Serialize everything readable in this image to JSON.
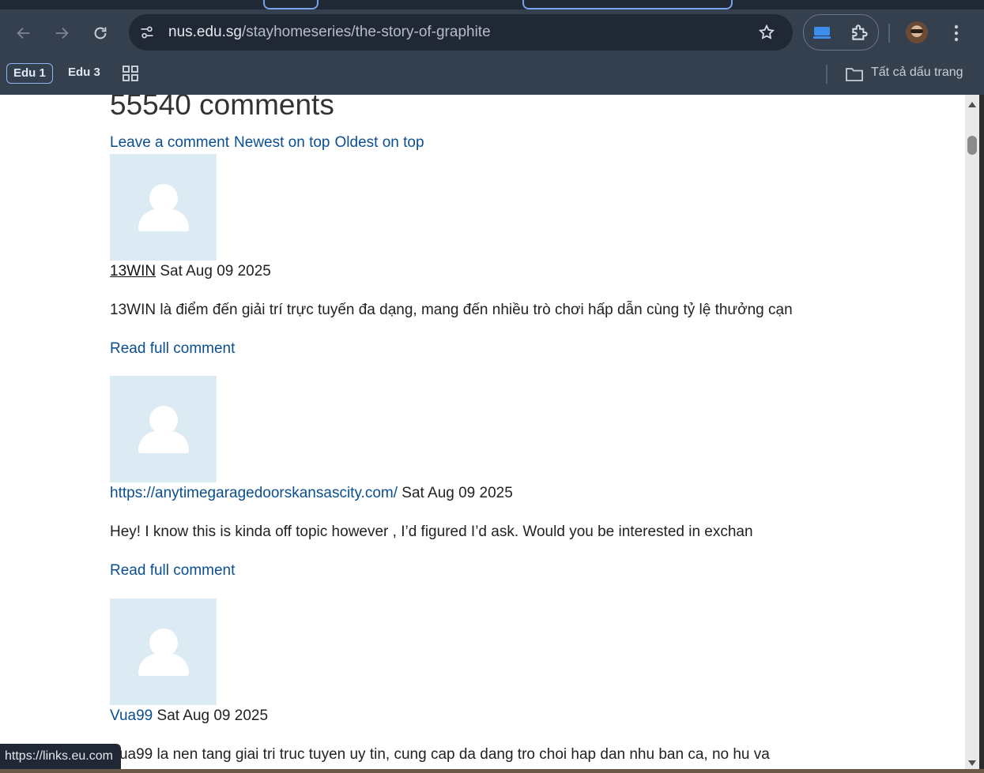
{
  "browser": {
    "url_host": "nus.edu.sg",
    "url_path": "/stayhomeseries/the-story-of-graphite",
    "bookmarks": [
      {
        "label": "Edu 1"
      },
      {
        "label": "Edu 3"
      }
    ],
    "all_bookmarks_label": "Tất cả dấu trang",
    "status_url": "https://links.eu.com"
  },
  "page": {
    "heading": "55540 comments",
    "actions": {
      "leave": "Leave a comment",
      "newest": "Newest on top",
      "oldest": "Oldest on top"
    },
    "comments": [
      {
        "author": "13WIN",
        "date": "Sat Aug 09 2025",
        "excerpt": "13WIN là điểm đến giải trí trực tuyến đa dạng, mang đến nhiều trò chơi hấp dẫn cùng tỷ lệ thưởng cạn",
        "read_more": "Read full comment"
      },
      {
        "author": "https://anytimegaragedoorskansascity.com/",
        "date": "Sat Aug 09 2025",
        "excerpt": "Hey! I know this is kinda off topic however , I’d figured I’d ask. Would you be interested in exchan",
        "read_more": "Read full comment"
      },
      {
        "author": "Vua99",
        "date": "Sat Aug 09 2025",
        "excerpt": "Vua99 la nen tang giai tri truc tuyen uy tin, cung cap da dang tro choi hap dan nhu ban ca, no hu va"
      }
    ]
  },
  "colors": {
    "link": "#0a4f8f",
    "chrome": "#35404f",
    "avatar_bg": "#dceaf4"
  }
}
